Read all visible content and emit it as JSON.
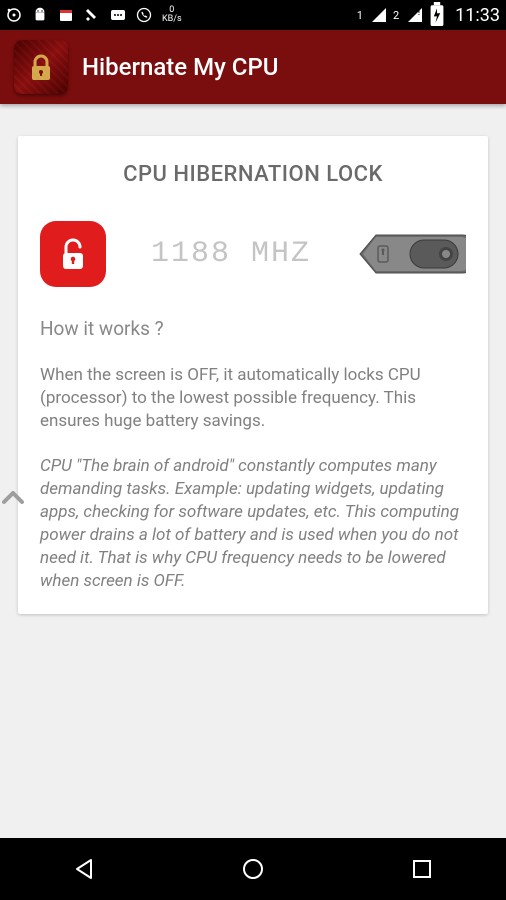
{
  "status": {
    "data_speed_value": "0",
    "data_speed_unit": "KB/s",
    "sim1": "1",
    "sim2": "2",
    "time": "11:33"
  },
  "appbar": {
    "title": "Hibernate My CPU"
  },
  "card": {
    "title": "CPU HIBERNATION LOCK",
    "frequency": "1188 MHZ",
    "how_title": "How it works ?",
    "para1": "When the screen is OFF, it automatically locks CPU (processor) to the lowest possible frequency. This ensures huge battery savings.",
    "para2": "CPU \"The brain of android\" constantly computes many demanding tasks. Example: updating widgets, updating apps, checking for software updates, etc. This computing power drains a lot of battery and is used when you do not need it. That is why CPU frequency needs to be lowered when screen is OFF."
  }
}
